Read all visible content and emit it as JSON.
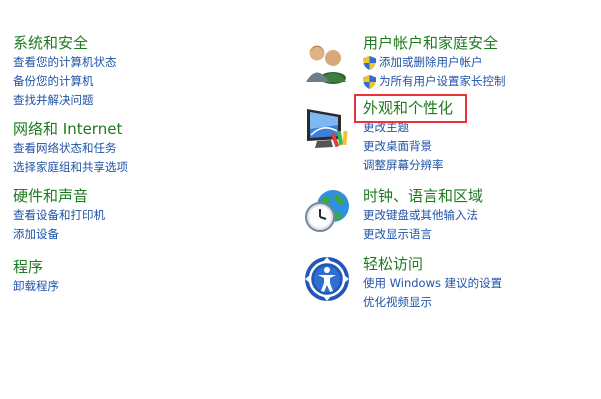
{
  "left": {
    "system": {
      "title": "系统和安全",
      "links": [
        "查看您的计算机状态",
        "备份您的计算机",
        "查找并解决问题"
      ]
    },
    "network": {
      "title": "网络和 Internet",
      "links": [
        "查看网络状态和任务",
        "选择家庭组和共享选项"
      ]
    },
    "hardware": {
      "title": "硬件和声音",
      "links": [
        "查看设备和打印机",
        "添加设备"
      ]
    },
    "programs": {
      "title": "程序",
      "links": [
        "卸载程序"
      ]
    }
  },
  "right": {
    "accounts": {
      "title": "用户帐户和家庭安全",
      "links": [
        "添加或删除用户帐户",
        "为所有用户设置家长控制"
      ],
      "icon": "users-icon"
    },
    "appearance": {
      "title": "外观和个性化",
      "links": [
        "更改主题",
        "更改桌面背景",
        "调整屏幕分辨率"
      ],
      "icon": "display-icon"
    },
    "clock": {
      "title": "时钟、语言和区域",
      "links": [
        "更改键盘或其他输入法",
        "更改显示语言"
      ],
      "icon": "clock-globe-icon"
    },
    "ease": {
      "title": "轻松访问",
      "links": [
        "使用 Windows 建议的设置",
        "优化视频显示"
      ],
      "icon": "ease-of-access-icon"
    }
  },
  "colors": {
    "title_green": "#1e7a1e",
    "link_blue": "#1f53a8",
    "highlight_red": "#e8333a"
  }
}
